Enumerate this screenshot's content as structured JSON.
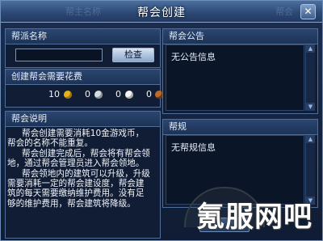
{
  "window": {
    "title": "帮会创建",
    "close_glyph": "✕",
    "bg_ghost_left": "帮主名称",
    "bg_ghost_right": "帮会"
  },
  "name_section": {
    "header": "帮派名称",
    "input_value": "",
    "check_button": "检查"
  },
  "cost_section": {
    "header": "创建帮会需要花费",
    "items": [
      {
        "amount": "10",
        "icon": "gold-coin-icon",
        "color": "#e3b21f"
      },
      {
        "amount": "0",
        "icon": "silver-coin-icon",
        "color": "#d7dbe2"
      },
      {
        "amount": "0",
        "icon": "white-coin-icon",
        "color": "#f4f4f4"
      },
      {
        "amount": "0",
        "icon": "copper-coin-icon",
        "color": "#c06a24"
      }
    ]
  },
  "description": {
    "header": "帮会说明",
    "paragraphs": [
      "帮会创建需要消耗10金游戏币，帮会的名称不能重复。",
      "帮会创建完成后，帮会将有帮会领地，通过帮会管理员进入帮会领地。",
      "帮会领地内的建筑可以升级，升级需要消耗一定的帮会建设度，帮会建筑的每天需要缴纳维护费用。没有足够的维护费用，帮会建筑将降级。"
    ]
  },
  "announcement": {
    "header": "帮会公告",
    "content": "无公告信息"
  },
  "rules": {
    "header": "帮规",
    "content": "无帮规信息"
  },
  "watermark": "氪服网吧"
}
